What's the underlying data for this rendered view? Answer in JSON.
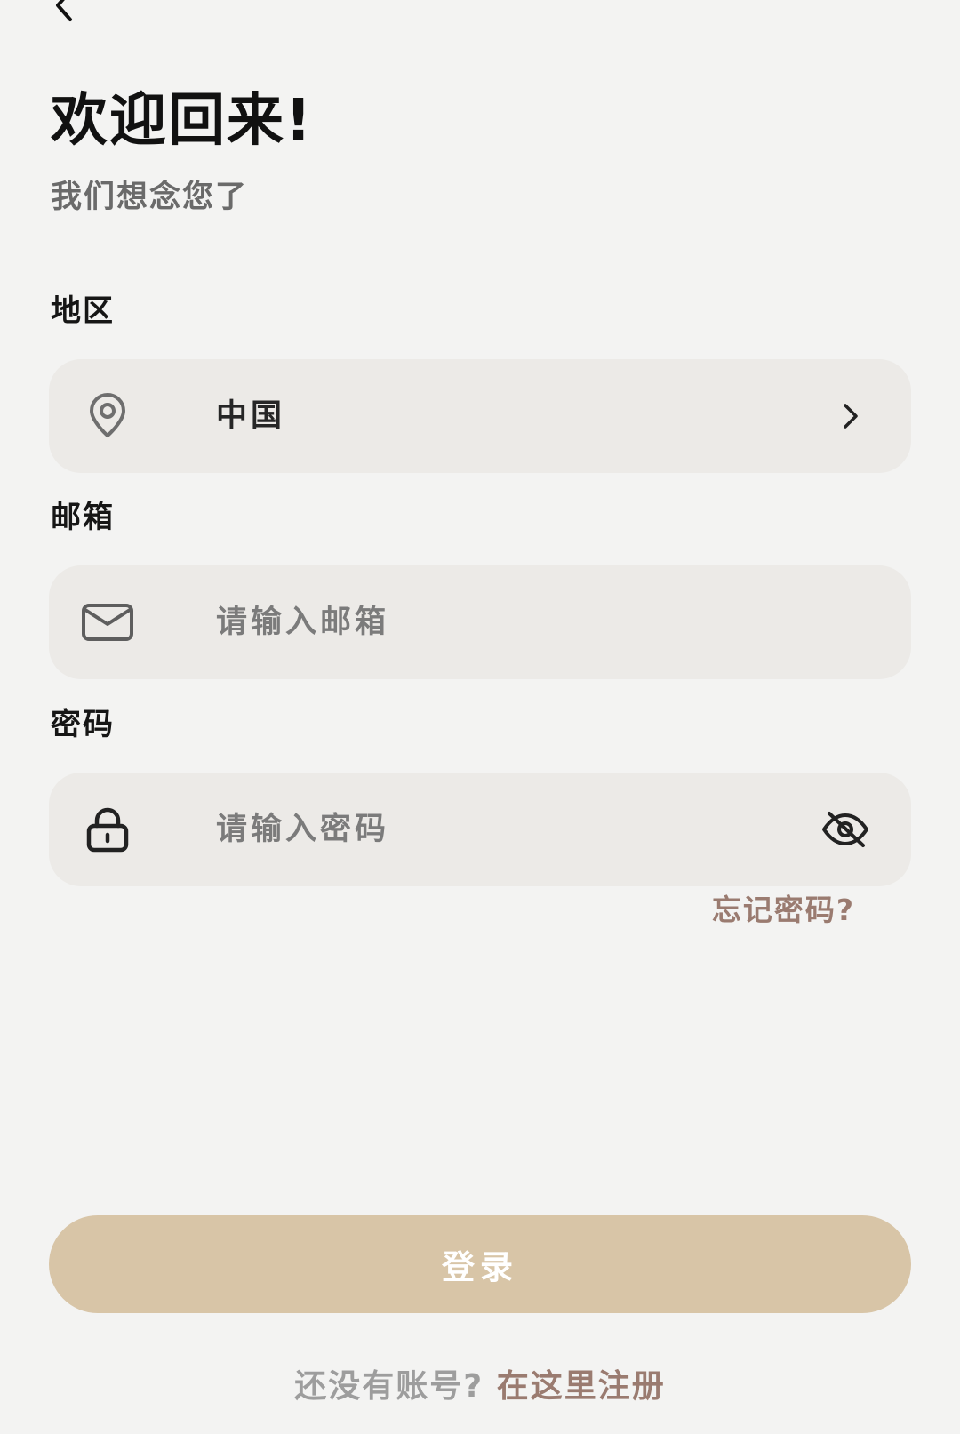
{
  "header": {
    "title": "欢迎回来!",
    "subtitle": "我们想念您了"
  },
  "form": {
    "region": {
      "label": "地区",
      "value": "中国",
      "icon": "location-pin-icon",
      "trailing_icon": "chevron-right-icon"
    },
    "email": {
      "label": "邮箱",
      "placeholder": "请输入邮箱",
      "value": "",
      "icon": "mail-icon"
    },
    "password": {
      "label": "密码",
      "placeholder": "请输入密码",
      "value": "",
      "icon": "lock-icon",
      "trailing_icon": "eye-off-icon"
    },
    "forgot_password": "忘记密码?"
  },
  "actions": {
    "login_label": "登录"
  },
  "footer": {
    "prompt": "还没有账号?",
    "register_link": "在这里注册"
  },
  "colors": {
    "background": "#f3f3f2",
    "field_background": "#eceae7",
    "accent": "#d8c5a7",
    "link": "#9a7b70"
  }
}
